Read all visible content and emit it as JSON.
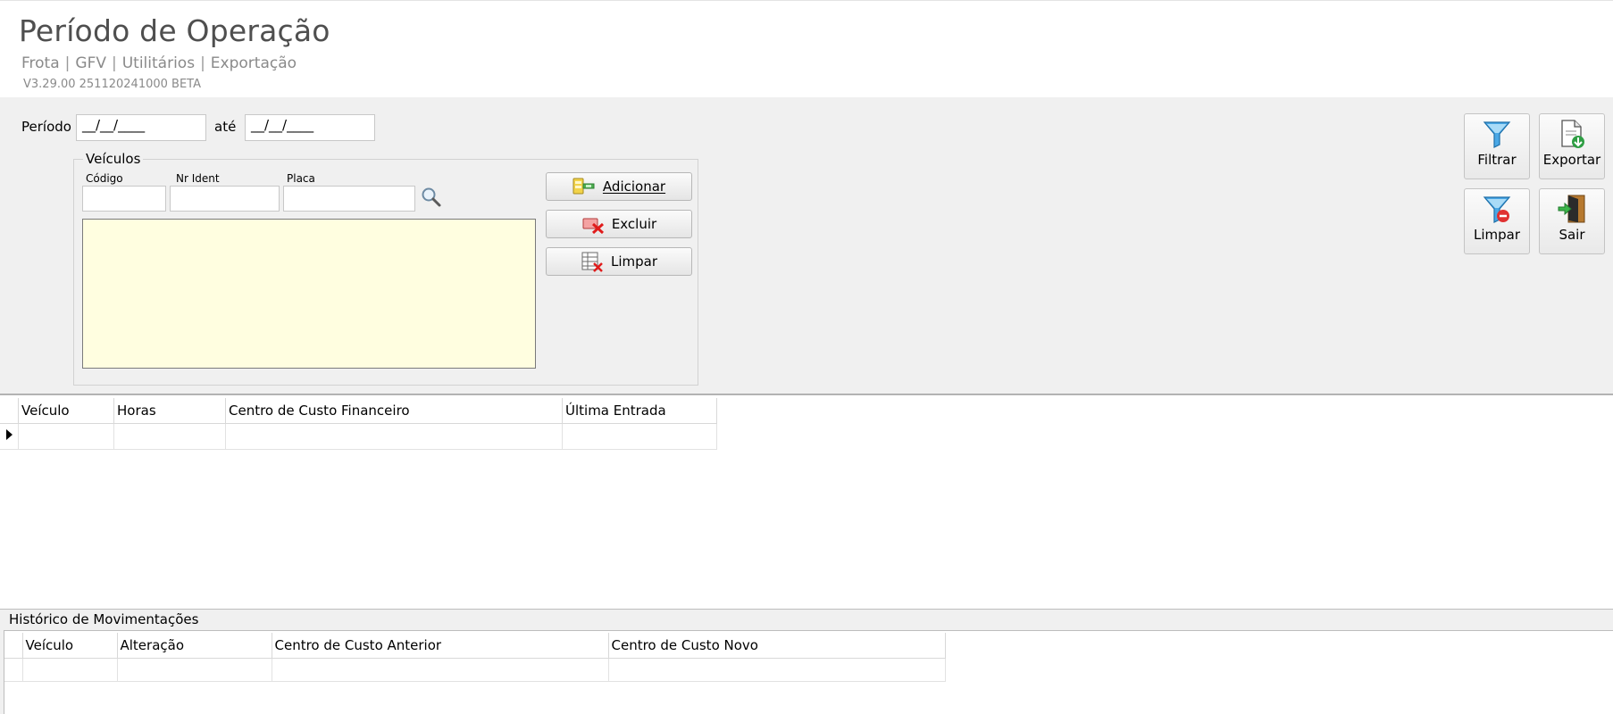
{
  "header": {
    "title": "Período de Operação",
    "breadcrumb": [
      "Frota",
      "GFV",
      "Utilitários",
      "Exportação"
    ],
    "version": "V3.29.00 251120241000 BETA"
  },
  "filters": {
    "periodo_label": "Período",
    "periodo_inicio": "__/__/____",
    "ate_label": "até",
    "periodo_fim": "__/__/____",
    "veiculos": {
      "legend": "Veículos",
      "codigo_label": "Código",
      "nrident_label": "Nr Ident",
      "placa_label": "Placa"
    },
    "buttons": {
      "adicionar": "Adicionar",
      "excluir": "Excluir",
      "limpar": "Limpar"
    }
  },
  "toolbar": {
    "filtrar": "Filtrar",
    "exportar": "Exportar",
    "limpar": "Limpar",
    "sair": "Sair"
  },
  "main_grid": {
    "columns": [
      "Veículo",
      "Horas",
      "Centro de Custo Financeiro",
      "Última Entrada"
    ]
  },
  "history": {
    "title": "Histórico de Movimentações",
    "columns": [
      "Veículo",
      "Alteração",
      "Centro de Custo Anterior",
      "Centro de Custo Novo"
    ]
  },
  "colors": {
    "list_background": "#fffee0",
    "panel_background": "#f0f0f0"
  }
}
